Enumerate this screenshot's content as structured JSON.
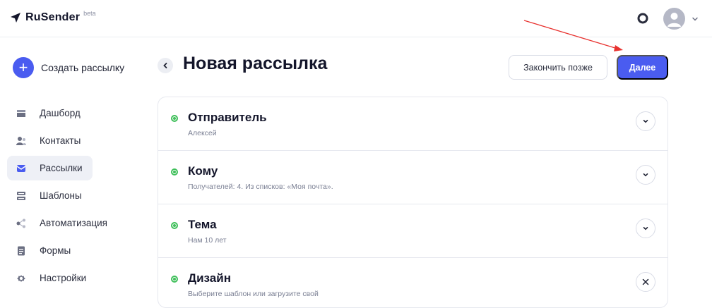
{
  "header": {
    "logo_text": "RuSender",
    "logo_badge": "beta",
    "help_icon": "lifebuoy-icon",
    "avatar_icon": "user-avatar-icon",
    "menu_icon": "chevron-down-icon"
  },
  "sidebar": {
    "create_label": "Создать рассылку",
    "create_icon": "plus-icon",
    "items": [
      {
        "label": "Дашборд",
        "icon": "dashboard-icon",
        "active": false
      },
      {
        "label": "Контакты",
        "icon": "contacts-icon",
        "active": false
      },
      {
        "label": "Рассылки",
        "icon": "mailings-icon",
        "active": true
      },
      {
        "label": "Шаблоны",
        "icon": "templates-icon",
        "active": false
      },
      {
        "label": "Автоматизация",
        "icon": "automation-icon",
        "active": false
      },
      {
        "label": "Формы",
        "icon": "forms-icon",
        "active": false
      },
      {
        "label": "Настройки",
        "icon": "settings-gear-icon",
        "active": false
      }
    ]
  },
  "main": {
    "title": "Новая рассылка",
    "back_icon": "chevron-left-icon",
    "later_label": "Закончить позже",
    "next_label": "Далее",
    "steps": [
      {
        "title": "Отправитель",
        "subtitle": "Алексей",
        "status": "complete",
        "toggle_icon": "chevron-down-icon"
      },
      {
        "title": "Кому",
        "subtitle": "Получателей: 4. Из списков: «Моя почта».",
        "status": "complete",
        "toggle_icon": "chevron-down-icon"
      },
      {
        "title": "Тема",
        "subtitle": "Нам 10 лет",
        "status": "complete",
        "toggle_icon": "chevron-down-icon"
      },
      {
        "title": "Дизайн",
        "subtitle": "Выберите шаблон или загрузите свой",
        "status": "complete",
        "toggle_icon": "close-icon"
      }
    ]
  },
  "colors": {
    "accent": "#4a5cf0",
    "success": "#3fbf5a",
    "annotation": "#e8322f"
  }
}
